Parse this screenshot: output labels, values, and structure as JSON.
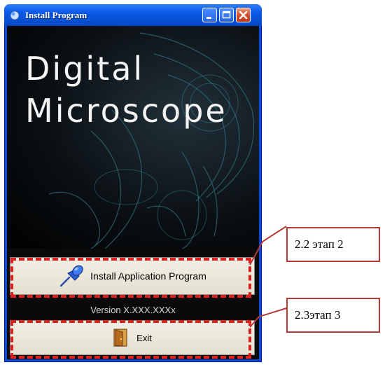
{
  "window": {
    "title": "Install  Program",
    "controls": {
      "minimize": "minimize-icon",
      "maximize": "maximize-icon",
      "close": "close-icon"
    }
  },
  "hero": {
    "line1": "Digital",
    "line2": "Microscope"
  },
  "buttons": {
    "install_label": "Install Application Program",
    "install_icon": "pushpin-icon",
    "exit_label": "Exit",
    "exit_icon": "door-exit-icon"
  },
  "version": "Version X.XXX.XXXx",
  "annotations": {
    "callout_1": "2.2 этап 2",
    "callout_2": "2.3этап 3"
  },
  "colors": {
    "titlebar": "#0a58e8",
    "annotation_red": "#e0201c",
    "callout_border": "#b73a35"
  }
}
